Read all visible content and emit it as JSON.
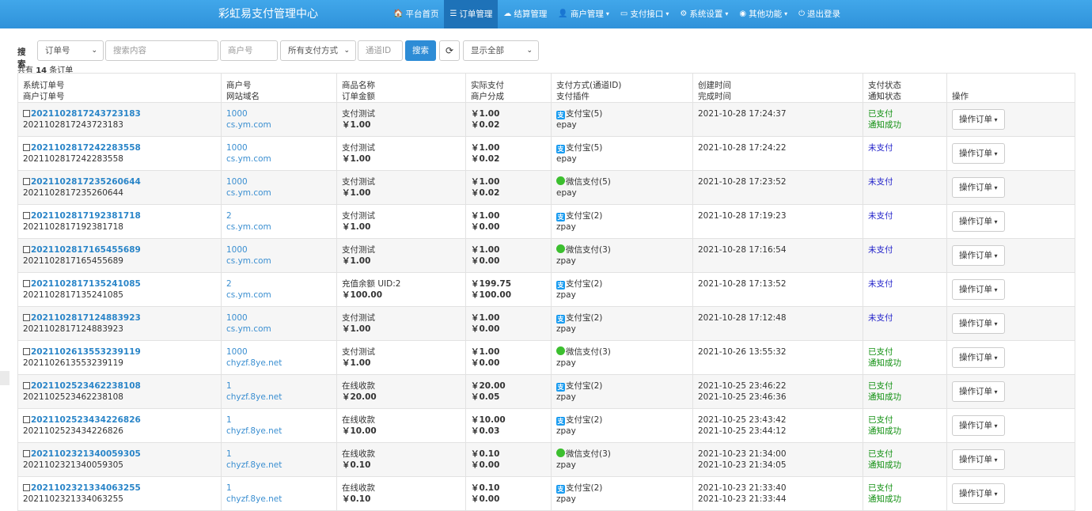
{
  "app": {
    "title": "彩虹易支付管理中心"
  },
  "nav": [
    {
      "icon": "home-icon",
      "glyph": "🏠",
      "label": "平台首页",
      "active": false,
      "caret": false
    },
    {
      "icon": "list-icon",
      "glyph": "☰",
      "label": "订单管理",
      "active": true,
      "caret": false
    },
    {
      "icon": "cloud-icon",
      "glyph": "☁",
      "label": "结算管理",
      "active": false,
      "caret": false
    },
    {
      "icon": "user-icon",
      "glyph": "👤",
      "label": "商户管理",
      "active": false,
      "caret": true
    },
    {
      "icon": "card-icon",
      "glyph": "▭",
      "label": "支付接口",
      "active": false,
      "caret": true
    },
    {
      "icon": "gear-icon",
      "glyph": "⚙",
      "label": "系统设置",
      "active": false,
      "caret": true
    },
    {
      "icon": "globe-icon",
      "glyph": "◉",
      "label": "其他功能",
      "active": false,
      "caret": true
    },
    {
      "icon": "power-icon",
      "glyph": "⏻",
      "label": "退出登录",
      "active": false,
      "caret": false
    }
  ],
  "filter": {
    "label": "搜索",
    "type_select": "订单号",
    "keyword_placeholder": "搜索内容",
    "merchant_placeholder": "商户号",
    "method_select": "所有支付方式",
    "channel_placeholder": "通道ID",
    "search_button": "搜索",
    "display_select": "显示全部"
  },
  "summary": {
    "prefix": "共有 ",
    "count": "14",
    "suffix": " 条订单"
  },
  "columns": [
    [
      "系统订单号",
      "商户订单号"
    ],
    [
      "商户号",
      "网站域名"
    ],
    [
      "商品名称",
      "订单金额"
    ],
    [
      "实际支付",
      "商户分成"
    ],
    [
      "支付方式(通道ID)",
      "支付插件"
    ],
    [
      "创建时间",
      "完成时间"
    ],
    [
      "支付状态",
      "通知状态"
    ],
    [
      "",
      "操作"
    ]
  ],
  "rows": [
    {
      "trade_no": "2021102817243723183",
      "out_trade_no": "2021102817243723183",
      "uid": "1000",
      "domain": "cs.ym.com",
      "name": "支付测试",
      "money": "￥1.00",
      "realmoney": "￥1.00",
      "getmoney": "￥0.02",
      "pay_type": "alipay",
      "pay_name": "支付宝(5)",
      "plugin": "epay",
      "addtime": "2021-10-28 17:24:37",
      "endtime": "",
      "status": "已支付",
      "status_kind": "paid",
      "notify": "通知成功",
      "op": "操作订单"
    },
    {
      "trade_no": "2021102817242283558",
      "out_trade_no": "2021102817242283558",
      "uid": "1000",
      "domain": "cs.ym.com",
      "name": "支付测试",
      "money": "￥1.00",
      "realmoney": "￥1.00",
      "getmoney": "￥0.02",
      "pay_type": "alipay",
      "pay_name": "支付宝(5)",
      "plugin": "epay",
      "addtime": "2021-10-28 17:24:22",
      "endtime": "",
      "status": "未支付",
      "status_kind": "unpaid",
      "notify": "",
      "op": "操作订单"
    },
    {
      "trade_no": "2021102817235260644",
      "out_trade_no": "2021102817235260644",
      "uid": "1000",
      "domain": "cs.ym.com",
      "name": "支付测试",
      "money": "￥1.00",
      "realmoney": "￥1.00",
      "getmoney": "￥0.02",
      "pay_type": "wechat",
      "pay_name": "微信支付(5)",
      "plugin": "epay",
      "addtime": "2021-10-28 17:23:52",
      "endtime": "",
      "status": "未支付",
      "status_kind": "unpaid",
      "notify": "",
      "op": "操作订单"
    },
    {
      "trade_no": "2021102817192381718",
      "out_trade_no": "2021102817192381718",
      "uid": "2",
      "domain": "cs.ym.com",
      "name": "支付测试",
      "money": "￥1.00",
      "realmoney": "￥1.00",
      "getmoney": "￥0.00",
      "pay_type": "alipay",
      "pay_name": "支付宝(2)",
      "plugin": "zpay",
      "addtime": "2021-10-28 17:19:23",
      "endtime": "",
      "status": "未支付",
      "status_kind": "unpaid",
      "notify": "",
      "op": "操作订单"
    },
    {
      "trade_no": "2021102817165455689",
      "out_trade_no": "2021102817165455689",
      "uid": "1000",
      "domain": "cs.ym.com",
      "name": "支付测试",
      "money": "￥1.00",
      "realmoney": "￥1.00",
      "getmoney": "￥0.00",
      "pay_type": "wechat",
      "pay_name": "微信支付(3)",
      "plugin": "zpay",
      "addtime": "2021-10-28 17:16:54",
      "endtime": "",
      "status": "未支付",
      "status_kind": "unpaid",
      "notify": "",
      "op": "操作订单"
    },
    {
      "trade_no": "2021102817135241085",
      "out_trade_no": "2021102817135241085",
      "uid": "2",
      "domain": "cs.ym.com",
      "name": "充值余额 UID:2",
      "money": "￥100.00",
      "realmoney": "￥199.75",
      "getmoney": "￥100.00",
      "pay_type": "alipay",
      "pay_name": "支付宝(2)",
      "plugin": "zpay",
      "addtime": "2021-10-28 17:13:52",
      "endtime": "",
      "status": "未支付",
      "status_kind": "unpaid",
      "notify": "",
      "op": "操作订单"
    },
    {
      "trade_no": "2021102817124883923",
      "out_trade_no": "2021102817124883923",
      "uid": "1000",
      "domain": "cs.ym.com",
      "name": "支付测试",
      "money": "￥1.00",
      "realmoney": "￥1.00",
      "getmoney": "￥0.00",
      "pay_type": "alipay",
      "pay_name": "支付宝(2)",
      "plugin": "zpay",
      "addtime": "2021-10-28 17:12:48",
      "endtime": "",
      "status": "未支付",
      "status_kind": "unpaid",
      "notify": "",
      "op": "操作订单"
    },
    {
      "trade_no": "2021102613553239119",
      "out_trade_no": "2021102613553239119",
      "uid": "1000",
      "domain": "chyzf.8ye.net",
      "name": "支付测试",
      "money": "￥1.00",
      "realmoney": "￥1.00",
      "getmoney": "￥0.00",
      "pay_type": "wechat",
      "pay_name": "微信支付(3)",
      "plugin": "zpay",
      "addtime": "2021-10-26 13:55:32",
      "endtime": "",
      "status": "已支付",
      "status_kind": "paid",
      "notify": "通知成功",
      "op": "操作订单"
    },
    {
      "trade_no": "2021102523462238108",
      "out_trade_no": "2021102523462238108",
      "uid": "1",
      "domain": "chyzf.8ye.net",
      "name": "在线收款",
      "money": "￥20.00",
      "realmoney": "￥20.00",
      "getmoney": "￥0.05",
      "pay_type": "alipay",
      "pay_name": "支付宝(2)",
      "plugin": "zpay",
      "addtime": "2021-10-25 23:46:22",
      "endtime": "2021-10-25 23:46:36",
      "status": "已支付",
      "status_kind": "paid",
      "notify": "通知成功",
      "op": "操作订单"
    },
    {
      "trade_no": "2021102523434226826",
      "out_trade_no": "2021102523434226826",
      "uid": "1",
      "domain": "chyzf.8ye.net",
      "name": "在线收款",
      "money": "￥10.00",
      "realmoney": "￥10.00",
      "getmoney": "￥0.03",
      "pay_type": "alipay",
      "pay_name": "支付宝(2)",
      "plugin": "zpay",
      "addtime": "2021-10-25 23:43:42",
      "endtime": "2021-10-25 23:44:12",
      "status": "已支付",
      "status_kind": "paid",
      "notify": "通知成功",
      "op": "操作订单"
    },
    {
      "trade_no": "2021102321340059305",
      "out_trade_no": "2021102321340059305",
      "uid": "1",
      "domain": "chyzf.8ye.net",
      "name": "在线收款",
      "money": "￥0.10",
      "realmoney": "￥0.10",
      "getmoney": "￥0.00",
      "pay_type": "wechat",
      "pay_name": "微信支付(3)",
      "plugin": "zpay",
      "addtime": "2021-10-23 21:34:00",
      "endtime": "2021-10-23 21:34:05",
      "status": "已支付",
      "status_kind": "paid",
      "notify": "通知成功",
      "op": "操作订单"
    },
    {
      "trade_no": "2021102321334063255",
      "out_trade_no": "2021102321334063255",
      "uid": "1",
      "domain": "chyzf.8ye.net",
      "name": "在线收款",
      "money": "￥0.10",
      "realmoney": "￥0.10",
      "getmoney": "￥0.00",
      "pay_type": "alipay",
      "pay_name": "支付宝(2)",
      "plugin": "zpay",
      "addtime": "2021-10-23 21:33:40",
      "endtime": "2021-10-23 21:33:44",
      "status": "已支付",
      "status_kind": "paid",
      "notify": "通知成功",
      "op": "操作订单"
    }
  ],
  "colors": {
    "nav_bg": "#3a9fe3",
    "nav_active": "#1e72b8",
    "link": "#2a85c8",
    "paid": "#119011",
    "unpaid": "#1f1fc9",
    "alipay": "#1a9cf0",
    "wechat": "#3cbf2f"
  }
}
